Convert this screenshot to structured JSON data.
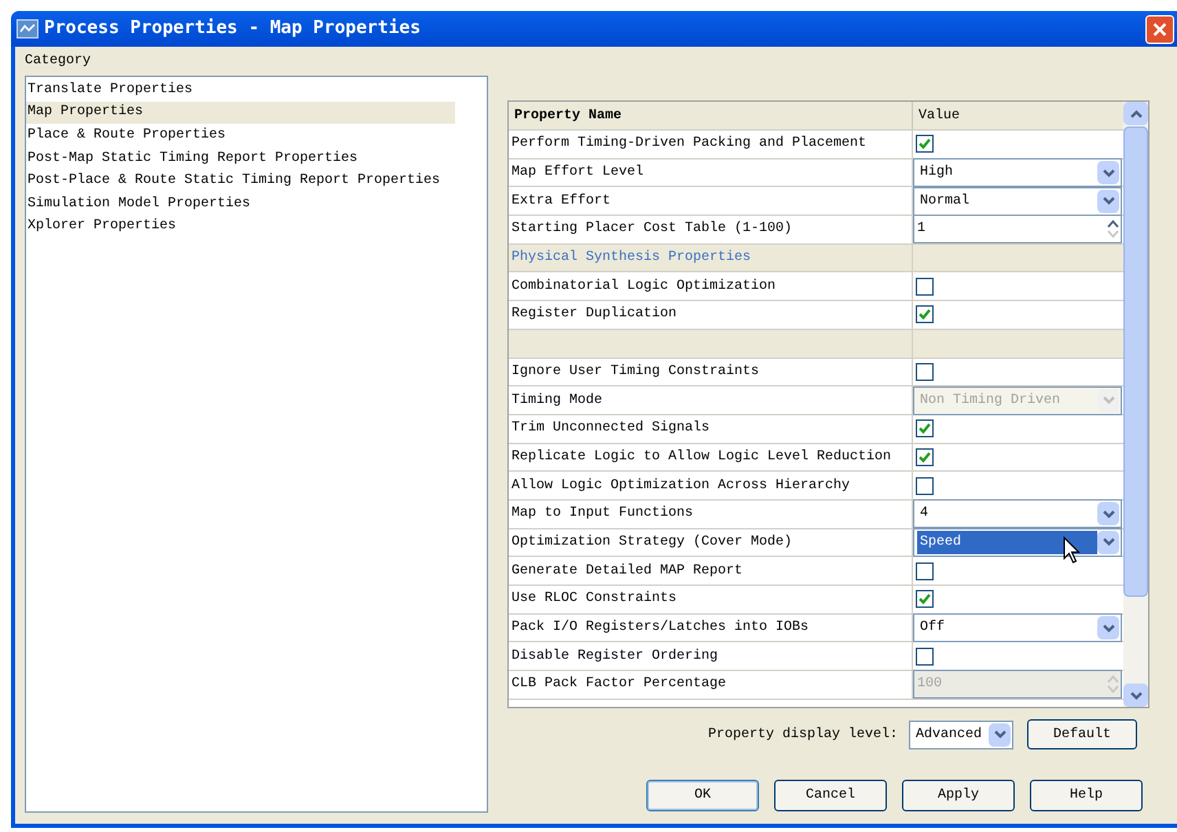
{
  "window": {
    "title": "Process Properties - Map Properties"
  },
  "category": {
    "label": "Category",
    "items": [
      {
        "label": "Translate Properties",
        "selected": false
      },
      {
        "label": "Map Properties",
        "selected": true
      },
      {
        "label": "Place & Route Properties",
        "selected": false
      },
      {
        "label": "Post-Map Static Timing Report Properties",
        "selected": false
      },
      {
        "label": "Post-Place & Route Static Timing Report Properties",
        "selected": false
      },
      {
        "label": "Simulation Model Properties",
        "selected": false
      },
      {
        "label": "Xplorer Properties",
        "selected": false
      }
    ]
  },
  "table": {
    "columns": [
      "Property Name",
      "Value"
    ],
    "rows": [
      {
        "kind": "checkbox",
        "name": "Perform Timing-Driven Packing and Placement",
        "checked": true
      },
      {
        "kind": "select",
        "name": "Map Effort Level",
        "value": "High",
        "disabled": false,
        "selected": false
      },
      {
        "kind": "select",
        "name": "Extra Effort",
        "value": "Normal",
        "disabled": false,
        "selected": false
      },
      {
        "kind": "spin",
        "name": "Starting Placer Cost Table (1-100)",
        "value": "1",
        "disabled": false
      },
      {
        "kind": "section",
        "name": "Physical Synthesis Properties"
      },
      {
        "kind": "checkbox",
        "name": "Combinatorial Logic Optimization",
        "checked": false
      },
      {
        "kind": "checkbox",
        "name": "Register Duplication",
        "checked": true
      },
      {
        "kind": "blank"
      },
      {
        "kind": "checkbox",
        "name": "Ignore User Timing Constraints",
        "checked": false
      },
      {
        "kind": "select",
        "name": "Timing Mode",
        "value": "Non Timing Driven",
        "disabled": true,
        "selected": false
      },
      {
        "kind": "checkbox",
        "name": "Trim Unconnected Signals",
        "checked": true
      },
      {
        "kind": "checkbox",
        "name": "Replicate Logic to Allow Logic Level Reduction",
        "checked": true
      },
      {
        "kind": "checkbox",
        "name": "Allow Logic Optimization Across Hierarchy",
        "checked": false
      },
      {
        "kind": "select",
        "name": "Map to Input Functions",
        "value": "4",
        "disabled": false,
        "selected": false
      },
      {
        "kind": "select",
        "name": "Optimization Strategy (Cover Mode)",
        "value": "Speed",
        "disabled": false,
        "selected": true
      },
      {
        "kind": "checkbox",
        "name": "Generate Detailed MAP Report",
        "checked": false
      },
      {
        "kind": "checkbox",
        "name": "Use RLOC Constraints",
        "checked": true
      },
      {
        "kind": "select",
        "name": "Pack I/O Registers/Latches into IOBs",
        "value": "Off",
        "disabled": false,
        "selected": false
      },
      {
        "kind": "checkbox",
        "name": "Disable Register Ordering",
        "checked": false
      },
      {
        "kind": "spin",
        "name": "CLB Pack Factor Percentage",
        "value": "100",
        "disabled": true
      }
    ]
  },
  "display_level": {
    "label": "Property display level:",
    "value": "Advanced"
  },
  "default_button": "Default",
  "buttons": [
    "OK",
    "Cancel",
    "Apply",
    "Help"
  ]
}
